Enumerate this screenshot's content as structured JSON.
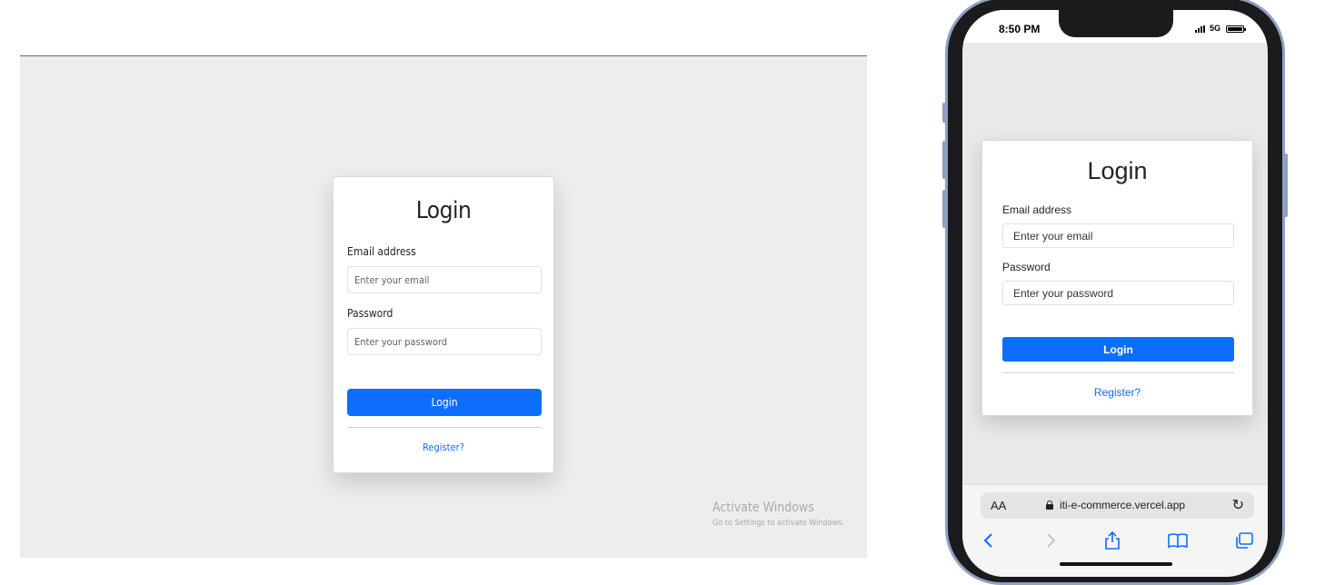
{
  "desktop": {
    "login_form": {
      "title": "Login",
      "email_label": "Email address",
      "email_placeholder": "Enter your email",
      "password_label": "Password",
      "password_placeholder": "Enter your password",
      "submit_label": "Login",
      "register_link": "Register?"
    },
    "watermark": {
      "title": "Activate Windows",
      "subtitle": "Go to Settings to activate Windows."
    }
  },
  "mobile": {
    "status_bar": {
      "time": "8:50 PM",
      "network": "5G",
      "signal_icon": "signal-bars-icon",
      "battery_icon": "battery-icon"
    },
    "login_form": {
      "title": "Login",
      "email_label": "Email address",
      "email_placeholder": "Enter your email",
      "password_label": "Password",
      "password_placeholder": "Enter your password",
      "submit_label": "Login",
      "register_link": "Register?"
    },
    "safari": {
      "text_size_label": "AA",
      "url": "iti-e-commerce.vercel.app",
      "toolbar_icons": [
        "back-icon",
        "forward-icon",
        "share-icon",
        "bookmarks-icon",
        "tabs-icon"
      ]
    }
  },
  "colors": {
    "primary": "#0d6efd",
    "page_background": "#ededed",
    "phone_frame": "#8ea2bf"
  }
}
